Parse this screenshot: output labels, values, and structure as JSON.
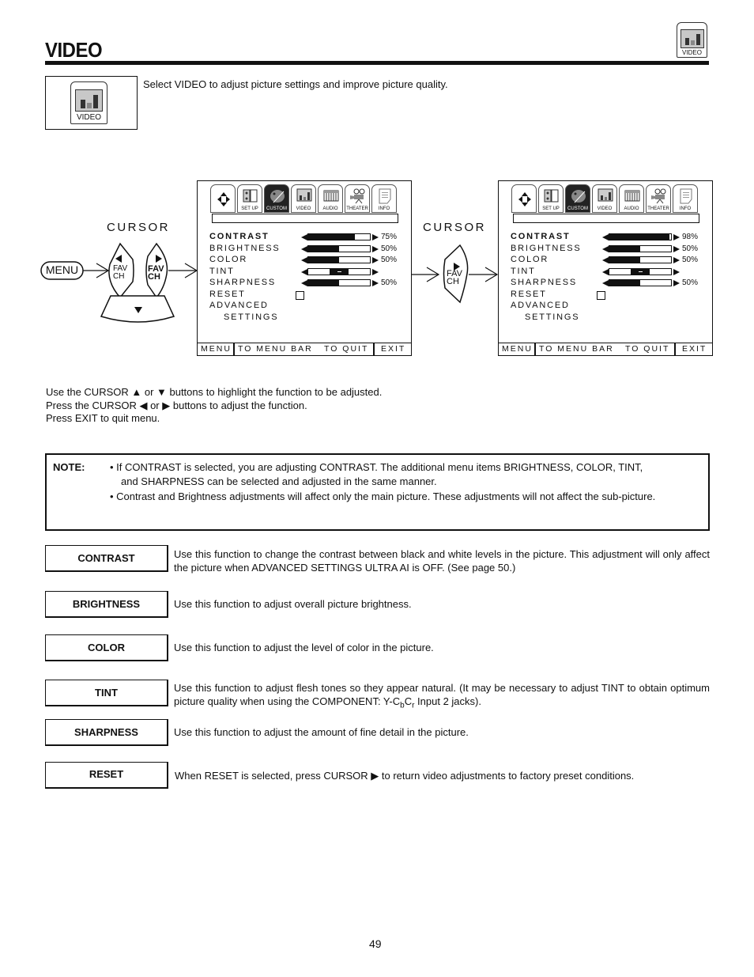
{
  "header": {
    "title": "VIDEO",
    "corner_icon": {
      "name": "video-icon",
      "label": "VIDEO"
    }
  },
  "intro": {
    "icon_label": "VIDEO",
    "text": "Select VIDEO to adjust picture settings and improve picture quality."
  },
  "diagram": {
    "menu_button": "MENU",
    "cursor_label_1": "CURSOR",
    "cursor_label_2": "CURSOR",
    "fav_label": "FAV",
    "ch_label": "CH",
    "tabs": [
      {
        "label": "",
        "icon": "cursor-arrows-icon",
        "active": false
      },
      {
        "label": "SET UP",
        "icon": "setup-icon",
        "active": false
      },
      {
        "label": "CUSTOM",
        "icon": "palette-icon",
        "active": true
      },
      {
        "label": "VIDEO",
        "icon": "video-icon",
        "active": false
      },
      {
        "label": "AUDIO",
        "icon": "keyboard-icon",
        "active": false
      },
      {
        "label": "THEATER",
        "icon": "movie-camera-icon",
        "active": false
      },
      {
        "label": "INFO",
        "icon": "document-icon",
        "active": false
      }
    ],
    "screens": [
      {
        "items": [
          {
            "label": "CONTRAST",
            "selected": true,
            "type": "slider",
            "value_pct": 75,
            "display": "75%"
          },
          {
            "label": "BRIGHTNESS",
            "type": "slider",
            "value_pct": 50,
            "display": "50%"
          },
          {
            "label": "COLOR",
            "type": "slider",
            "value_pct": 50,
            "display": "50%"
          },
          {
            "label": "TINT",
            "type": "tint",
            "value_pct": 50,
            "display": ""
          },
          {
            "label": "SHARPNESS",
            "type": "slider",
            "value_pct": 50,
            "display": "50%"
          },
          {
            "label": "RESET",
            "type": "checkbox"
          },
          {
            "label": "ADVANCED",
            "type": "none"
          },
          {
            "label": "SETTINGS",
            "type": "none"
          }
        ],
        "footer": {
          "menu": "MENU",
          "to_menu_bar": "TO MENU BAR",
          "to_quit": "TO QUIT",
          "exit": "EXIT"
        }
      },
      {
        "items": [
          {
            "label": "CONTRAST",
            "selected": true,
            "type": "slider",
            "value_pct": 98,
            "display": "98%"
          },
          {
            "label": "BRIGHTNESS",
            "type": "slider",
            "value_pct": 50,
            "display": "50%"
          },
          {
            "label": "COLOR",
            "type": "slider",
            "value_pct": 50,
            "display": "50%"
          },
          {
            "label": "TINT",
            "type": "tint",
            "value_pct": 50,
            "display": ""
          },
          {
            "label": "SHARPNESS",
            "type": "slider",
            "value_pct": 50,
            "display": "50%"
          },
          {
            "label": "RESET",
            "type": "checkbox"
          },
          {
            "label": "ADVANCED",
            "type": "none"
          },
          {
            "label": "SETTINGS",
            "type": "none"
          }
        ],
        "footer": {
          "menu": "MENU",
          "to_menu_bar": "TO MENU BAR",
          "to_quit": "TO QUIT",
          "exit": "EXIT"
        }
      }
    ]
  },
  "instructions": [
    "Use the CURSOR ▲ or ▼ buttons to highlight the function to be adjusted.",
    "Press the CURSOR ◀ or ▶ buttons to adjust the function.",
    "Press EXIT to quit menu."
  ],
  "note": {
    "label": "NOTE:",
    "bullet1_line1": "• If CONTRAST is selected, you are adjusting CONTRAST.  The additional menu items BRIGHTNESS, COLOR, TINT,",
    "bullet1_line2": "and SHARPNESS can be selected and adjusted in the same manner.",
    "bullet2": "• Contrast and Brightness adjustments will affect only the main picture. These adjustments will not affect the sub-picture."
  },
  "functions": [
    {
      "name": "CONTRAST",
      "desc": "Use this function to change the contrast between black and white levels in the picture.  This adjustment will only affect the picture when ADVANCED SETTINGS ULTRA AI is OFF. (See page 50.)"
    },
    {
      "name": "BRIGHTNESS",
      "desc": "Use this function to adjust overall picture brightness."
    },
    {
      "name": "COLOR",
      "desc": "Use this function to adjust the level of color in the picture."
    },
    {
      "name": "TINT",
      "desc_a": "Use this function to adjust flesh tones so they appear natural. (It may be necessary to adjust TINT to obtain optimum picture quality when using the COMPONENT: Y-C",
      "sub_b": "b",
      "mid": "C",
      "sub_r": "r",
      "desc_b": " Input 2 jacks)."
    },
    {
      "name": "SHARPNESS",
      "desc": "Use this function to adjust the amount of fine detail in the picture."
    },
    {
      "name": "RESET",
      "desc": "When RESET is selected, press CURSOR ▶ to return video adjustments to factory preset conditions."
    }
  ],
  "page_number": "49"
}
